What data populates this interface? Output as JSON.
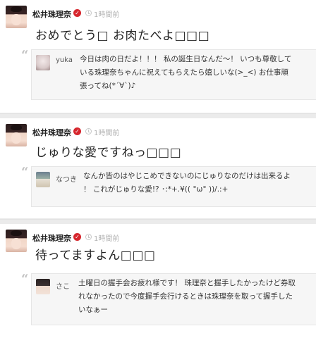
{
  "time_label": "1時間前",
  "posts": [
    {
      "author": "松井珠理奈",
      "time": "1時間前",
      "text": "おめでとう□ お肉たべよ□□□",
      "reply": {
        "name": "yuka",
        "line1": "今日は肉の日だよ！！！ 私の誕生日なんだ〜！ いつも尊敬して",
        "line2": "いる珠理奈ちゃんに祝えてもらえたら嬉しいな(>_<) お仕事頑",
        "line3": "張ってね(*´∀`)♪"
      }
    },
    {
      "author": "松井珠理奈",
      "time": "1時間前",
      "text": "じゅりな愛ですねっ□□□",
      "reply": {
        "name": "なつき",
        "line1": "なんか皆のはやじこめできないのにじゅりなのだけは出来るよ",
        "line2": "！ これがじゅりな愛!? ･:*+.¥(( °ω° ))/.:+",
        "line3": ""
      }
    },
    {
      "author": "松井珠理奈",
      "time": "1時間前",
      "text": "待ってますよん□□□",
      "reply": {
        "name": "さこ",
        "line1": "土曜日の握手会お疲れ様です！ 珠理奈と握手したかったけど券取",
        "line2": "れなかったので今度握手会行けるときは珠理奈を取って握手した",
        "line3": "いなぁー"
      }
    }
  ],
  "icons": {
    "verified": "verified-badge-icon",
    "clock": "clock-icon",
    "quote": "quote-icon"
  },
  "colors": {
    "background": "#ebebeb",
    "card": "#ffffff",
    "reply_box": "#f6f6f6",
    "verified_red": "#d6262d",
    "muted": "#b3b3b3"
  }
}
